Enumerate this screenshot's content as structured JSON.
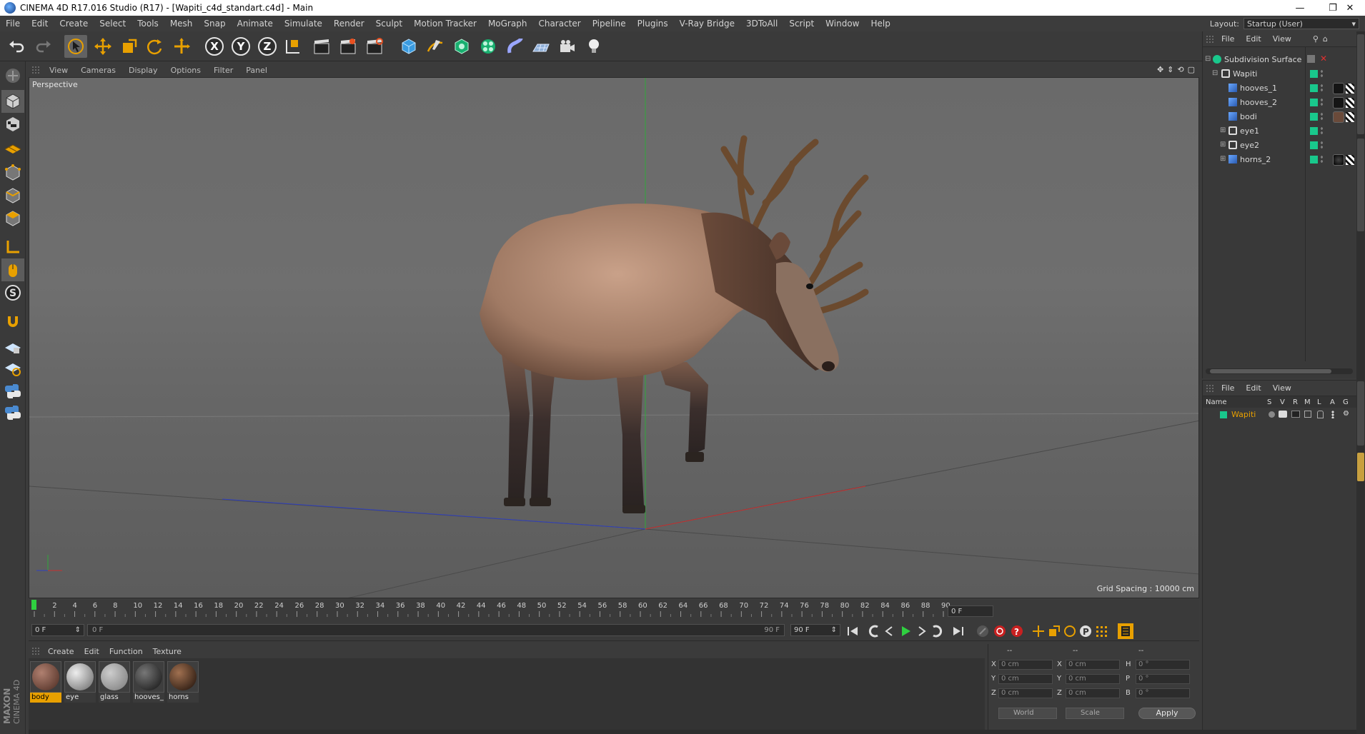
{
  "window": {
    "title": "CINEMA 4D R17.016 Studio (R17) - [Wapiti_c4d_standart.c4d] - Main"
  },
  "menubar": [
    "File",
    "Edit",
    "Create",
    "Select",
    "Tools",
    "Mesh",
    "Snap",
    "Animate",
    "Simulate",
    "Render",
    "Sculpt",
    "Motion Tracker",
    "MoGraph",
    "Character",
    "Pipeline",
    "Plugins",
    "V-Ray Bridge",
    "3DToAll",
    "Script",
    "Window",
    "Help"
  ],
  "layout": {
    "label": "Layout:",
    "value": "Startup (User)"
  },
  "viewport": {
    "menu": [
      "View",
      "Cameras",
      "Display",
      "Options",
      "Filter",
      "Panel"
    ],
    "camera_label": "Perspective",
    "grid_spacing": "Grid Spacing : 10000 cm"
  },
  "timeline": {
    "ticks": [
      "0",
      "2",
      "4",
      "6",
      "8",
      "10",
      "12",
      "14",
      "16",
      "18",
      "20",
      "22",
      "24",
      "26",
      "28",
      "30",
      "32",
      "34",
      "36",
      "38",
      "40",
      "42",
      "44",
      "46",
      "48",
      "50",
      "52",
      "54",
      "56",
      "58",
      "60",
      "62",
      "64",
      "66",
      "68",
      "70",
      "72",
      "74",
      "76",
      "78",
      "80",
      "82",
      "84",
      "86",
      "88",
      "90"
    ],
    "current_frame": "0 F",
    "start_frame": "0 F",
    "range_start": "0 F",
    "range_end": "90 F",
    "end_frame": "90 F"
  },
  "materials": {
    "menu": [
      "Create",
      "Edit",
      "Function",
      "Texture"
    ],
    "items": [
      {
        "name": "body",
        "selected": true
      },
      {
        "name": "eye",
        "selected": false
      },
      {
        "name": "glass",
        "selected": false
      },
      {
        "name": "hooves_",
        "selected": false
      },
      {
        "name": "horns",
        "selected": false
      }
    ]
  },
  "coordinates": {
    "header": [
      "--",
      "--",
      "--"
    ],
    "rows": [
      {
        "a_label": "X",
        "a_value": "0 cm",
        "b_label": "X",
        "b_value": "0 cm",
        "c_label": "H",
        "c_value": "0 °"
      },
      {
        "a_label": "Y",
        "a_value": "0 cm",
        "b_label": "Y",
        "b_value": "0 cm",
        "c_label": "P",
        "c_value": "0 °"
      },
      {
        "a_label": "Z",
        "a_value": "0 cm",
        "b_label": "Z",
        "b_value": "0 cm",
        "c_label": "B",
        "c_value": "0 °"
      }
    ],
    "space": "World",
    "mode": "Scale",
    "apply_label": "Apply"
  },
  "object_manager": {
    "menu": [
      "File",
      "Edit",
      "View"
    ],
    "objects": [
      {
        "name": "Subdivision Surface",
        "kind": "subdivision"
      },
      {
        "name": "Wapiti",
        "kind": "null"
      },
      {
        "name": "hooves_1",
        "kind": "poly"
      },
      {
        "name": "hooves_2",
        "kind": "poly"
      },
      {
        "name": "bodi",
        "kind": "poly"
      },
      {
        "name": "eye1",
        "kind": "null"
      },
      {
        "name": "eye2",
        "kind": "null"
      },
      {
        "name": "horns_2",
        "kind": "poly"
      }
    ]
  },
  "layer_manager": {
    "menu": [
      "File",
      "Edit",
      "View"
    ],
    "columns": [
      "Name",
      "S",
      "V",
      "R",
      "M",
      "L",
      "A",
      "G"
    ],
    "layers": [
      {
        "name": "Wapiti",
        "color": "#19c88c"
      }
    ]
  },
  "colors": {
    "accent": "#e8a000",
    "layer_green": "#19c88c",
    "axis_x": "#c83030",
    "axis_y": "#2fa83a",
    "axis_z": "#3040c0"
  }
}
